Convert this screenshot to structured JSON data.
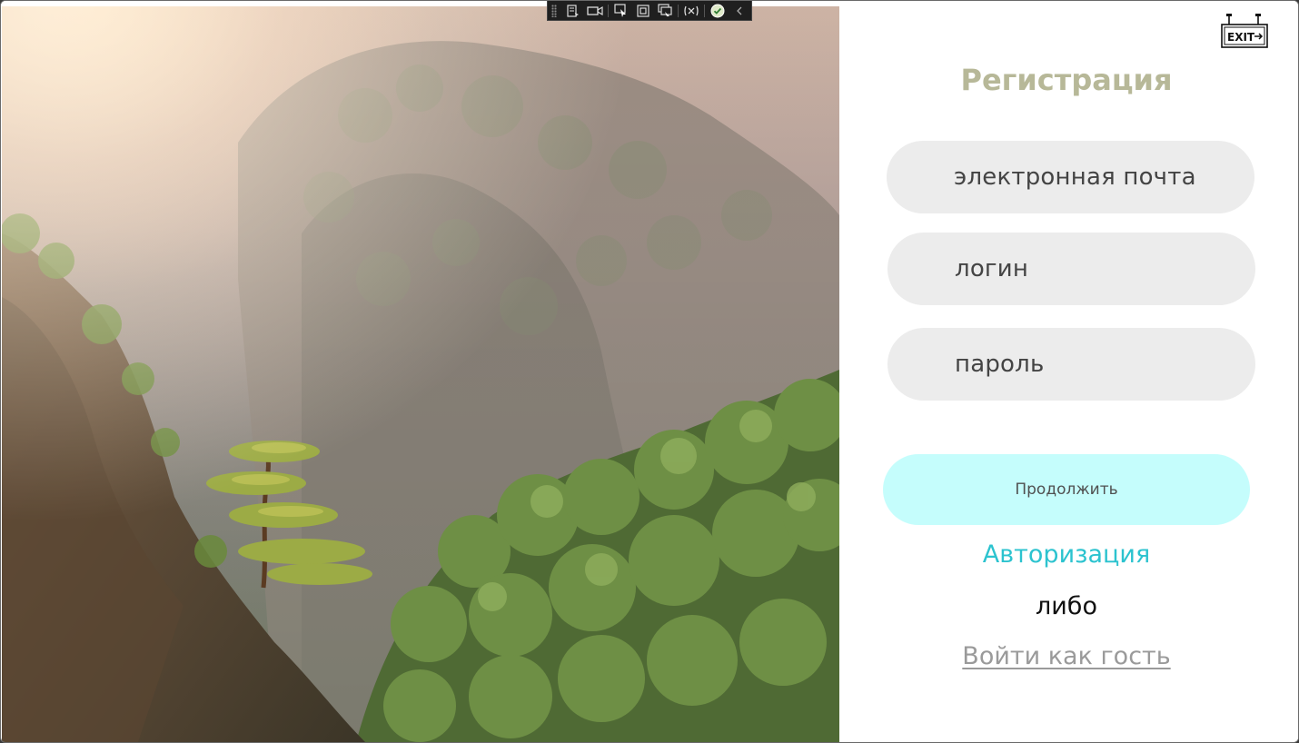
{
  "page": {
    "title": "Регистрация"
  },
  "form": {
    "email_placeholder": "электронная почта",
    "login_placeholder": "логин",
    "password_placeholder": "пароль",
    "continue_label": "Продолжить"
  },
  "links": {
    "auth_label": "Авторизация",
    "or_label": "либо",
    "guest_label": "Войти как гость"
  },
  "exit": {
    "sign_text": "EXIT",
    "icon": "exit-sign-icon"
  },
  "devtools": {
    "icons": [
      "live-visual-tree-icon",
      "video-record-icon",
      "select-element-icon",
      "display-layout-adorners-icon",
      "track-focus-icon",
      "binding-failures-icon",
      "hot-reload-ok-icon",
      "collapse-chevron-icon"
    ]
  },
  "colors": {
    "title": "#b7b898",
    "field_bg": "#ececec",
    "continue_bg": "#c5fdfc",
    "auth_link": "#2cc3cf",
    "guest_link": "#9a9a9a"
  }
}
